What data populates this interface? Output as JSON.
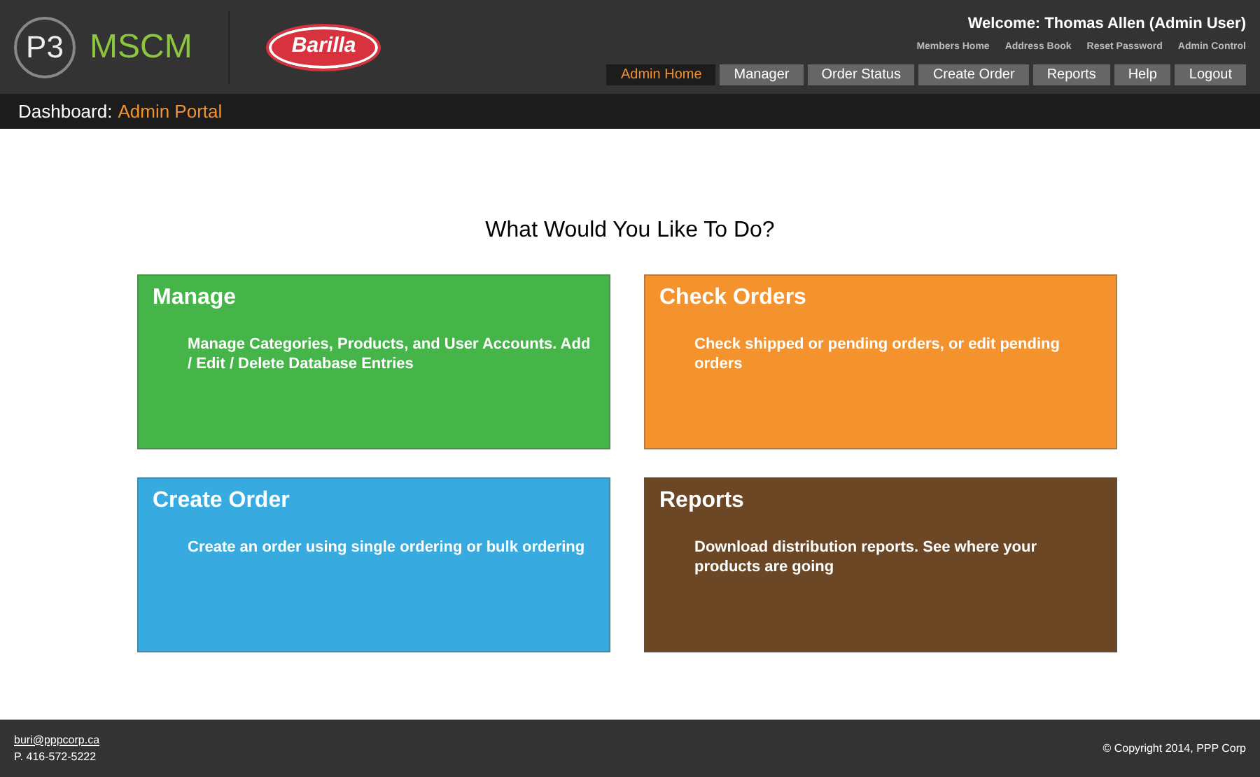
{
  "header": {
    "logo_mark": "P3",
    "logo_text": "MSCM",
    "brand": "Barilla",
    "welcome": "Welcome: Thomas Allen (Admin User)",
    "links": [
      "Members Home",
      "Address Book",
      "Reset Password",
      "Admin Control"
    ],
    "nav": [
      {
        "label": "Admin Home",
        "selected": true
      },
      {
        "label": "Manager",
        "selected": false
      },
      {
        "label": "Order Status",
        "selected": false
      },
      {
        "label": "Create Order",
        "selected": false
      },
      {
        "label": "Reports",
        "selected": false
      },
      {
        "label": "Help",
        "selected": false
      },
      {
        "label": "Logout",
        "selected": false
      }
    ]
  },
  "breadcrumb": {
    "label": "Dashboard:",
    "value": "Admin Portal"
  },
  "heading": "What Would You Like To Do?",
  "cards": [
    {
      "title": "Manage",
      "description": "Manage Categories, Products, and User Accounts. Add / Edit / Delete Database Entries",
      "color": "#45b549"
    },
    {
      "title": "Check Orders",
      "description": "Check shipped or pending orders, or edit pending orders",
      "color": "#f4922e"
    },
    {
      "title": "Create Order",
      "description": "Create an order using single ordering or bulk ordering",
      "color": "#37abe0"
    },
    {
      "title": "Reports",
      "description": "Download distribution reports. See where your products are going",
      "color": "#6c4725"
    }
  ],
  "footer": {
    "email": "buri@pppcorp.ca",
    "phone": "P. 416-572-5222",
    "copyright": "© Copyright 2014, PPP Corp"
  }
}
